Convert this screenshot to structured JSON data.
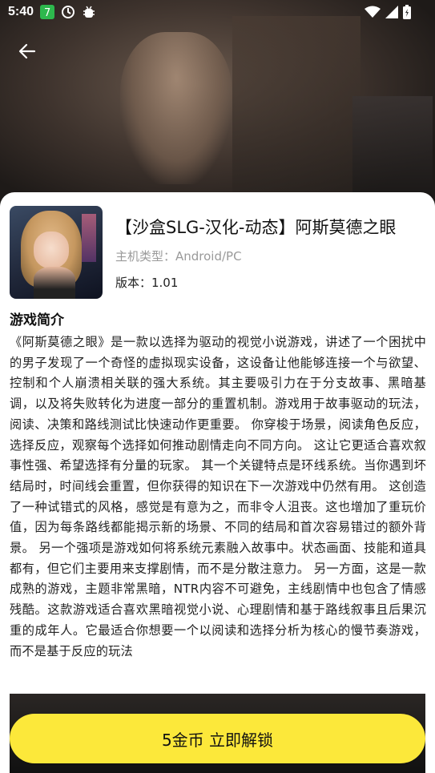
{
  "status_bar": {
    "time": "5:40"
  },
  "game": {
    "title": "【沙盒SLG-汉化-动态】阿斯莫德之眼",
    "platform": "主机类型：Android/PC",
    "version": "版本：1.01"
  },
  "intro": {
    "heading": "游戏简介",
    "body": "《阿斯莫德之眼》是一款以选择为驱动的视觉小说游戏，讲述了一个困扰中的男子发现了一个奇怪的虚拟现实设备，这设备让他能够连接一个与欲望、控制和个人崩溃相关联的强大系统。其主要吸引力在于分支故事、黑暗基调，以及将失败转化为进度一部分的重置机制。游戏用于故事驱动的玩法，阅读、决策和路线测试比快速动作更重要。 你穿梭于场景，阅读角色反应，选择反应，观察每个选择如何推动剧情走向不同方向。 这让它更适合喜欢叙事性强、希望选择有分量的玩家。 其一个关键特点是环线系统。当你遇到坏结局时，时间线会重置，但你获得的知识在下一次游戏中仍然有用。 这创造了一种试错式的风格，感觉是有意为之，而非令人沮丧。这也增加了重玩价值，因为每条路线都能揭示新的场景、不同的结局和首次容易错过的额外背景。 另一个强项是游戏如何将系统元素融入故事中。状态画面、技能和道具都有，但它们主要用来支撑剧情，而不是分散注意力。 另一方面，这是一款成熟的游戏，主题非常黑暗，NTR内容不可避免，主线剧情中也包含了情感残酷。这款游戏适合喜欢黑暗视觉小说、心理剧情和基于路线叙事且后果沉重的成年人。它最适合你想要一个以阅读和选择分析为核心的慢节奏游戏，而不是基于反应的玩法"
  },
  "unlock_button": {
    "label": "5金币 立即解锁"
  },
  "icons": [
    "back-arrow-icon",
    "wifi-icon",
    "signal-icon",
    "battery-icon",
    "notification-app-icon",
    "sync-icon",
    "debug-icon"
  ]
}
